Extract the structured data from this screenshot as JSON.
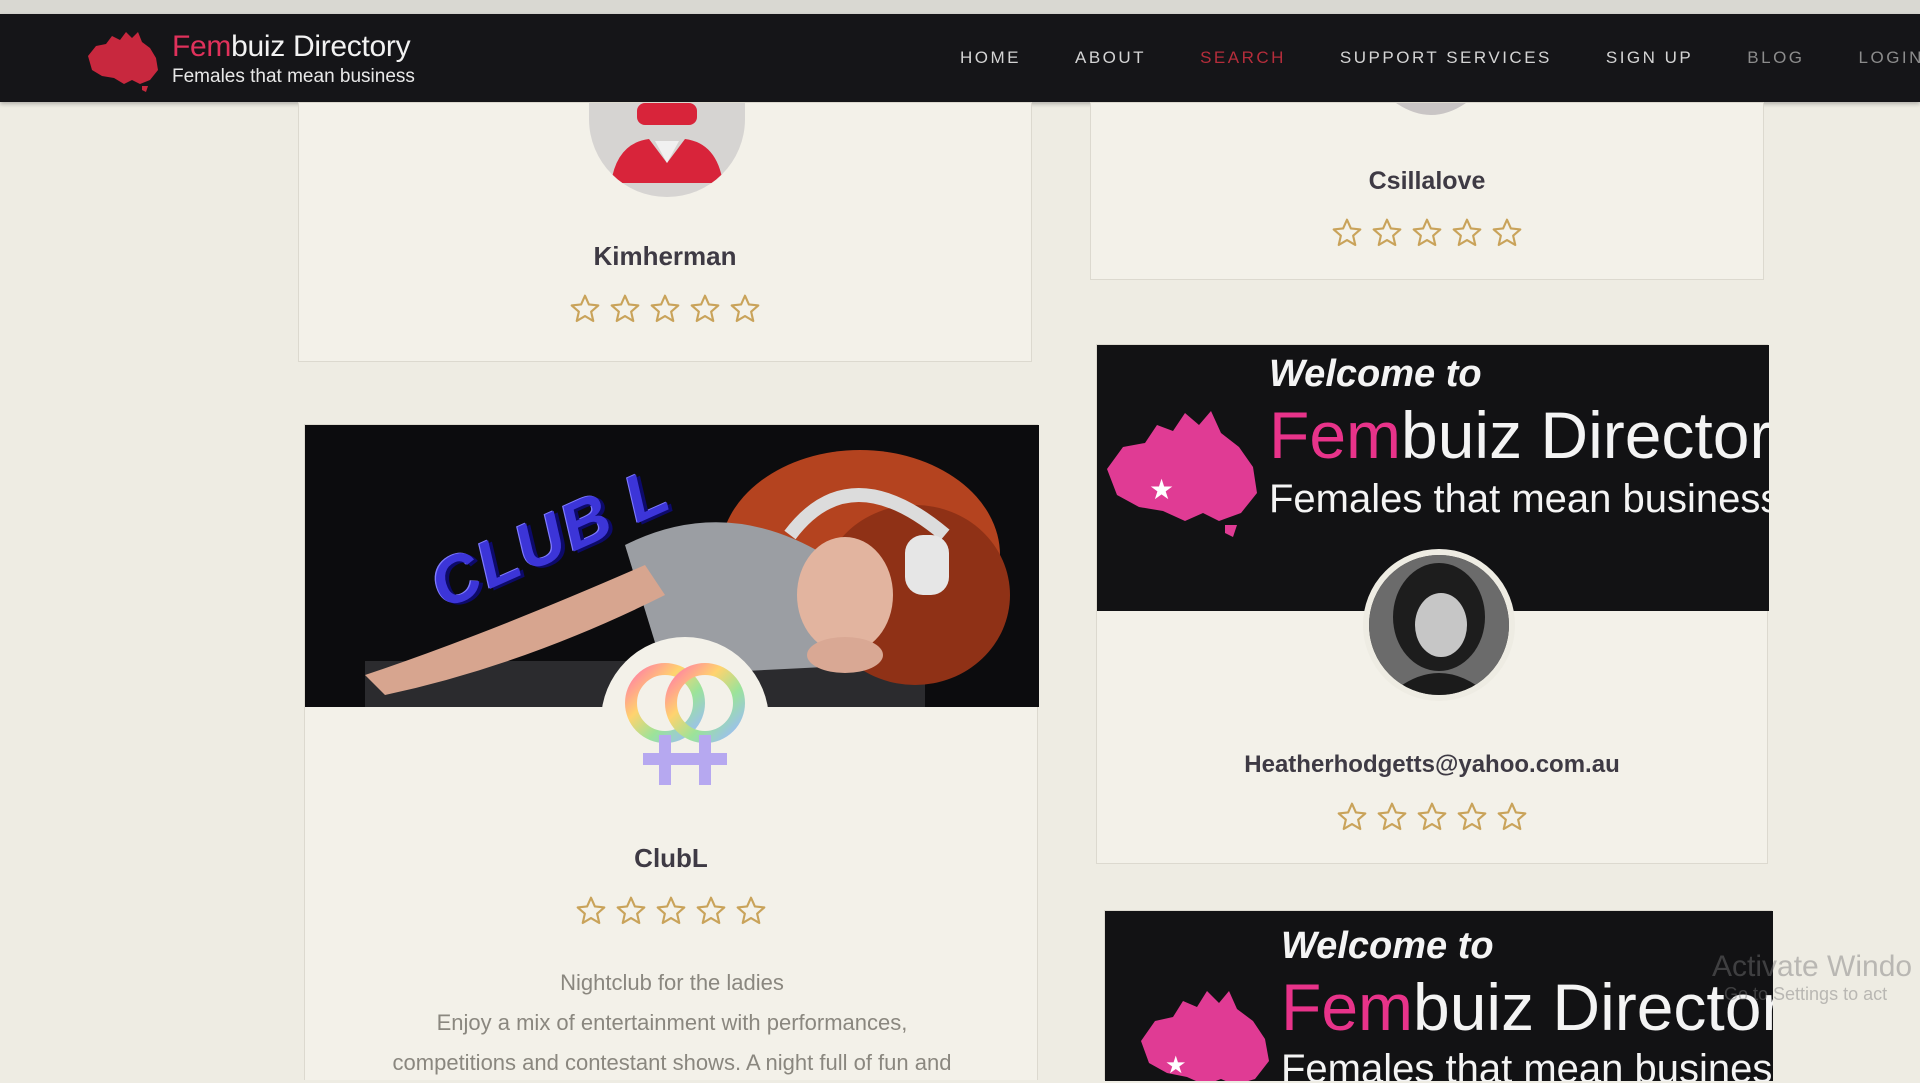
{
  "brand": {
    "title_fem": "Fem",
    "title_rest": "buiz Directory",
    "tagline": "Females that mean business"
  },
  "nav": [
    {
      "label": "HOME",
      "state": "normal"
    },
    {
      "label": "ABOUT",
      "state": "normal"
    },
    {
      "label": "SEARCH",
      "state": "active"
    },
    {
      "label": "SUPPORT SERVICES",
      "state": "normal"
    },
    {
      "label": "SIGN UP",
      "state": "normal"
    },
    {
      "label": "BLOG",
      "state": "faded"
    },
    {
      "label": "LOGIN",
      "state": "faded"
    }
  ],
  "cards": {
    "kimherman": {
      "name": "Kimherman",
      "rating": 0
    },
    "csillalove": {
      "name": "Csillalove",
      "rating": 0
    },
    "clubl": {
      "name": "ClubL",
      "rating": 0,
      "banner_text": "CLUB L",
      "description": [
        "Nightclub for the ladies",
        "Enjoy a mix of entertainment with performances,",
        "competitions and contestant shows. A night full of fun and"
      ]
    },
    "heather": {
      "name": "Heatherhodgetts@yahoo.com.au",
      "rating": 0,
      "banner": {
        "welcome": "Welcome to",
        "title_fem": "Fem",
        "title_rest": "buiz Directory",
        "tagline": "Females that mean business"
      }
    },
    "bottom": {
      "banner": {
        "welcome": "Welcome to",
        "title_fem": "Fem",
        "title_rest": "buiz Directory",
        "tagline": "Females that mean business"
      }
    }
  },
  "watermark": {
    "line1": "Activate Windo",
    "line2": "Go to Settings to act"
  },
  "colors": {
    "nav_bg": "#151518",
    "brand_red": "#e0315b",
    "brand_pink": "#e8338a",
    "nav_active": "#b52d3b",
    "star": "#c9a35a",
    "page_bg": "#eeece3"
  }
}
